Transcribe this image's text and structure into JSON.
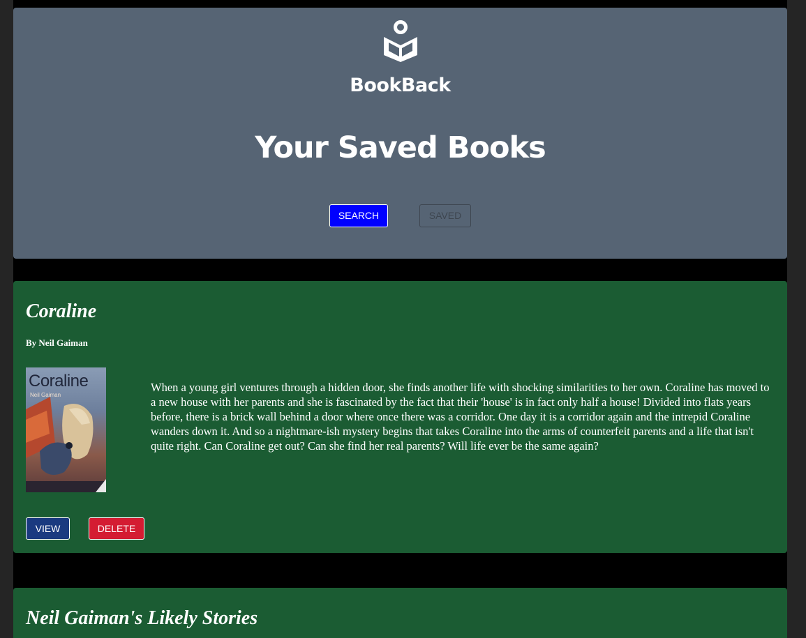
{
  "app": {
    "brand_name": "BookBack",
    "logo_icon": "open-book-reader-icon"
  },
  "header": {
    "page_title": "Your Saved Books",
    "nav": {
      "search_label": "SEARCH",
      "saved_label": "SAVED"
    }
  },
  "books": [
    {
      "title": "Coraline",
      "author": "By Neil Gaiman",
      "cover_title": "Coraline",
      "cover_author": "Neil Gaiman",
      "description": "When a young girl ventures through a hidden door, she finds another life with shocking similarities to her own. Coraline has moved to a new house with her parents and she is fascinated by the fact that their 'house' is in fact only half a house! Divided into flats years before, there is a brick wall behind a door where once there was a corridor. One day it is a corridor again and the intrepid Coraline wanders down it. And so a nightmare-ish mystery begins that takes Coraline into the arms of counterfeit parents and a life that isn't quite right. Can Coraline get out? Can she find her real parents? Will life ever be the same again?",
      "view_label": "VIEW",
      "delete_label": "DELETE"
    },
    {
      "title": "Neil Gaiman's Likely Stories"
    }
  ],
  "colors": {
    "header_bg": "#566474",
    "card_bg": "#1b5c33",
    "search_button": "#0000ff",
    "view_button": "#1a3a80",
    "delete_button": "#d41c32"
  }
}
